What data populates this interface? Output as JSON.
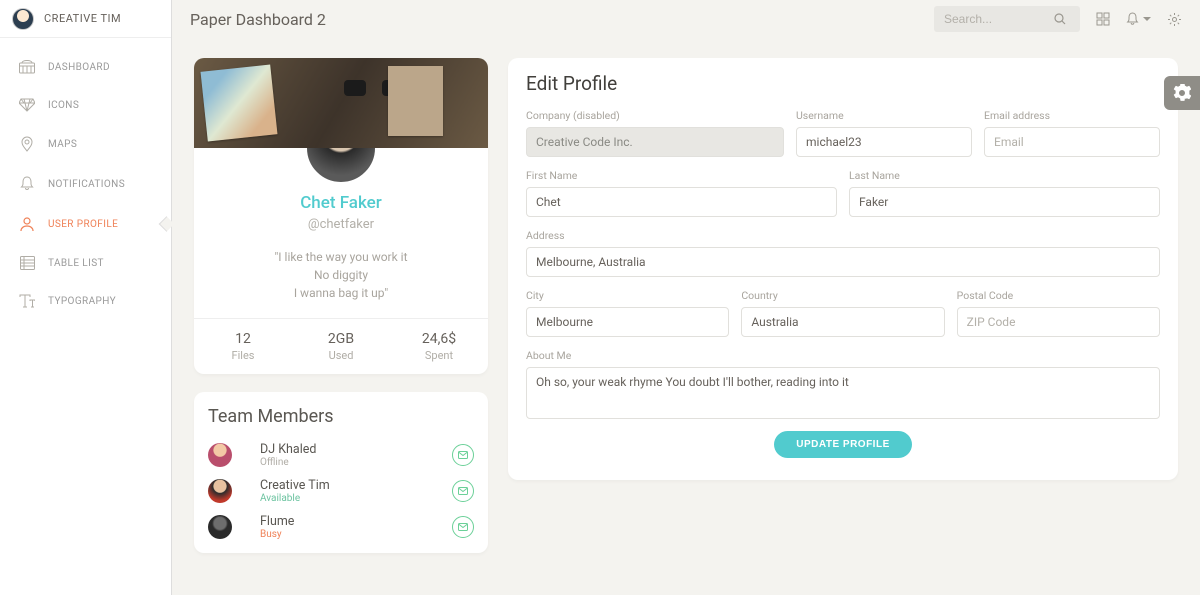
{
  "brand": "CREATIVE TIM",
  "page_title": "Paper Dashboard 2",
  "search_placeholder": "Search...",
  "nav": [
    {
      "label": "DASHBOARD"
    },
    {
      "label": "ICONS"
    },
    {
      "label": "MAPS"
    },
    {
      "label": "NOTIFICATIONS"
    },
    {
      "label": "USER PROFILE"
    },
    {
      "label": "TABLE LIST"
    },
    {
      "label": "TYPOGRAPHY"
    }
  ],
  "profile": {
    "name": "Chet Faker",
    "handle": "@chetfaker",
    "quote1": "\"I like the way you work it",
    "quote2": "No diggity",
    "quote3": "I wanna bag it up\"",
    "stats": [
      {
        "value": "12",
        "label": "Files"
      },
      {
        "value": "2GB",
        "label": "Used"
      },
      {
        "value": "24,6$",
        "label": "Spent"
      }
    ]
  },
  "team": {
    "heading": "Team Members",
    "members": [
      {
        "name": "DJ Khaled",
        "status": "Offline",
        "status_class": "status-offline"
      },
      {
        "name": "Creative Tim",
        "status": "Available",
        "status_class": "status-available"
      },
      {
        "name": "Flume",
        "status": "Busy",
        "status_class": "status-busy"
      }
    ]
  },
  "form": {
    "heading": "Edit Profile",
    "labels": {
      "company": "Company (disabled)",
      "username": "Username",
      "email": "Email address",
      "first": "First Name",
      "last": "Last Name",
      "address": "Address",
      "city": "City",
      "country": "Country",
      "zip": "Postal Code",
      "about": "About Me"
    },
    "values": {
      "company": "Creative Code Inc.",
      "username": "michael23",
      "first": "Chet",
      "last": "Faker",
      "address": "Melbourne, Australia",
      "city": "Melbourne",
      "country": "Australia",
      "about": "Oh so, your weak rhyme You doubt I'll bother, reading into it"
    },
    "placeholders": {
      "email": "Email",
      "zip": "ZIP Code"
    },
    "submit": "UPDATE PROFILE"
  }
}
